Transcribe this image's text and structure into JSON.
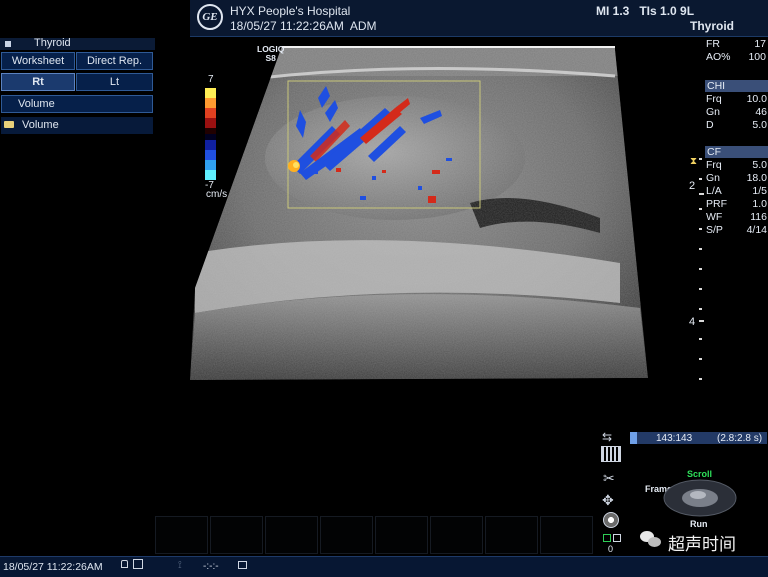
{
  "header": {
    "logo_text": "GE",
    "hospital": "HYX People's Hospital",
    "datetime": "18/05/27 11:22:26AM",
    "operator": "ADM",
    "mi_tis": "MI 1.3   TIs 1.0 9L",
    "preset": "Thyroid"
  },
  "left_panel": {
    "title": "Thyroid",
    "worksheet": "Worksheet",
    "direct_rep": "Direct Rep.",
    "rt": "Rt",
    "lt": "Lt",
    "volume_button": "Volume",
    "volume_folder": "Volume"
  },
  "probe": {
    "label1": "LOGIQ",
    "label2": "S8"
  },
  "color_bar": {
    "top": "7",
    "bottom": "-7",
    "unit": "cm/s"
  },
  "right_panel": {
    "fr_label": "FR",
    "fr_value": "17",
    "ao_label": "AO%",
    "ao_value": "100",
    "chi_head": "CHI",
    "chi": [
      {
        "label": "Frq",
        "value": "10.0"
      },
      {
        "label": "Gn",
        "value": "46"
      },
      {
        "label": "D",
        "value": "5.0"
      }
    ],
    "cf_head": "CF",
    "cf": [
      {
        "label": "Frq",
        "value": "5.0"
      },
      {
        "label": "Gn",
        "value": "18.0"
      },
      {
        "label": "L/A",
        "value": "1/5"
      },
      {
        "label": "PRF",
        "value": "1.0"
      },
      {
        "label": "WF",
        "value": "116"
      },
      {
        "label": "S/P",
        "value": "4/14"
      }
    ],
    "depth_marks": [
      "2",
      "4"
    ]
  },
  "cine": {
    "label": "143:143",
    "time": "(2.8:2.8 s)",
    "counter": "0"
  },
  "trackball": {
    "top": "Scroll",
    "left": "Frame",
    "bottom": "Run"
  },
  "status": {
    "datetime": "18/05/27 11:22:26AM",
    "code": "-:-:-"
  },
  "watermark": {
    "text": "超声时间"
  },
  "colors": {
    "doppler_red": "#d42a1a",
    "doppler_blue": "#1f4fe0",
    "panel": "#06204a"
  }
}
